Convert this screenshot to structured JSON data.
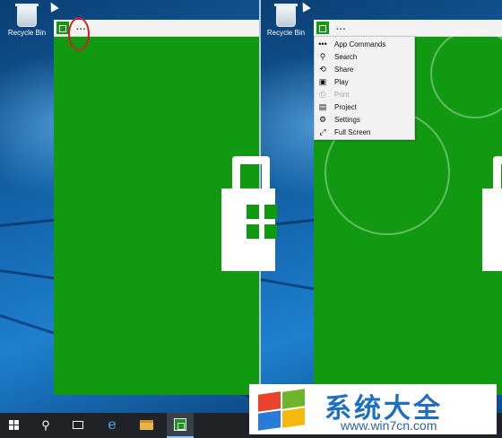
{
  "desktop": {
    "recycle_bin_label": "Recycle Bin"
  },
  "left_app": {
    "more_label": "..."
  },
  "right_app": {
    "more_label": "...",
    "menu": [
      {
        "id": "app-commands",
        "label": "App Commands",
        "icon": "more-icon",
        "glyph": "•••",
        "disabled": false
      },
      {
        "id": "search",
        "label": "Search",
        "icon": "search-icon",
        "glyph": "⚲",
        "disabled": false
      },
      {
        "id": "share",
        "label": "Share",
        "icon": "share-icon",
        "glyph": "⟲",
        "disabled": false
      },
      {
        "id": "play",
        "label": "Play",
        "icon": "play-icon",
        "glyph": "▣",
        "disabled": false
      },
      {
        "id": "print",
        "label": "Print",
        "icon": "print-icon",
        "glyph": "⎙",
        "disabled": true
      },
      {
        "id": "project",
        "label": "Project",
        "icon": "project-icon",
        "glyph": "▤",
        "disabled": false
      },
      {
        "id": "settings",
        "label": "Settings",
        "icon": "gear-icon",
        "glyph": "⚙",
        "disabled": false
      },
      {
        "id": "full-screen",
        "label": "Full Screen",
        "icon": "fullscreen-icon",
        "glyph": "⤢",
        "disabled": false
      }
    ]
  },
  "taskbar": {
    "search_glyph": "⚲",
    "ie_glyph": "e"
  },
  "watermark": {
    "title": "系统大全",
    "url": "www.win7cn.com"
  },
  "colors": {
    "app_green": "#119a11",
    "titlebar": "#f2f2f2",
    "highlight_red": "#d21f26",
    "taskbar": "#1f2328",
    "watermark_blue": "#1d6fc1"
  }
}
